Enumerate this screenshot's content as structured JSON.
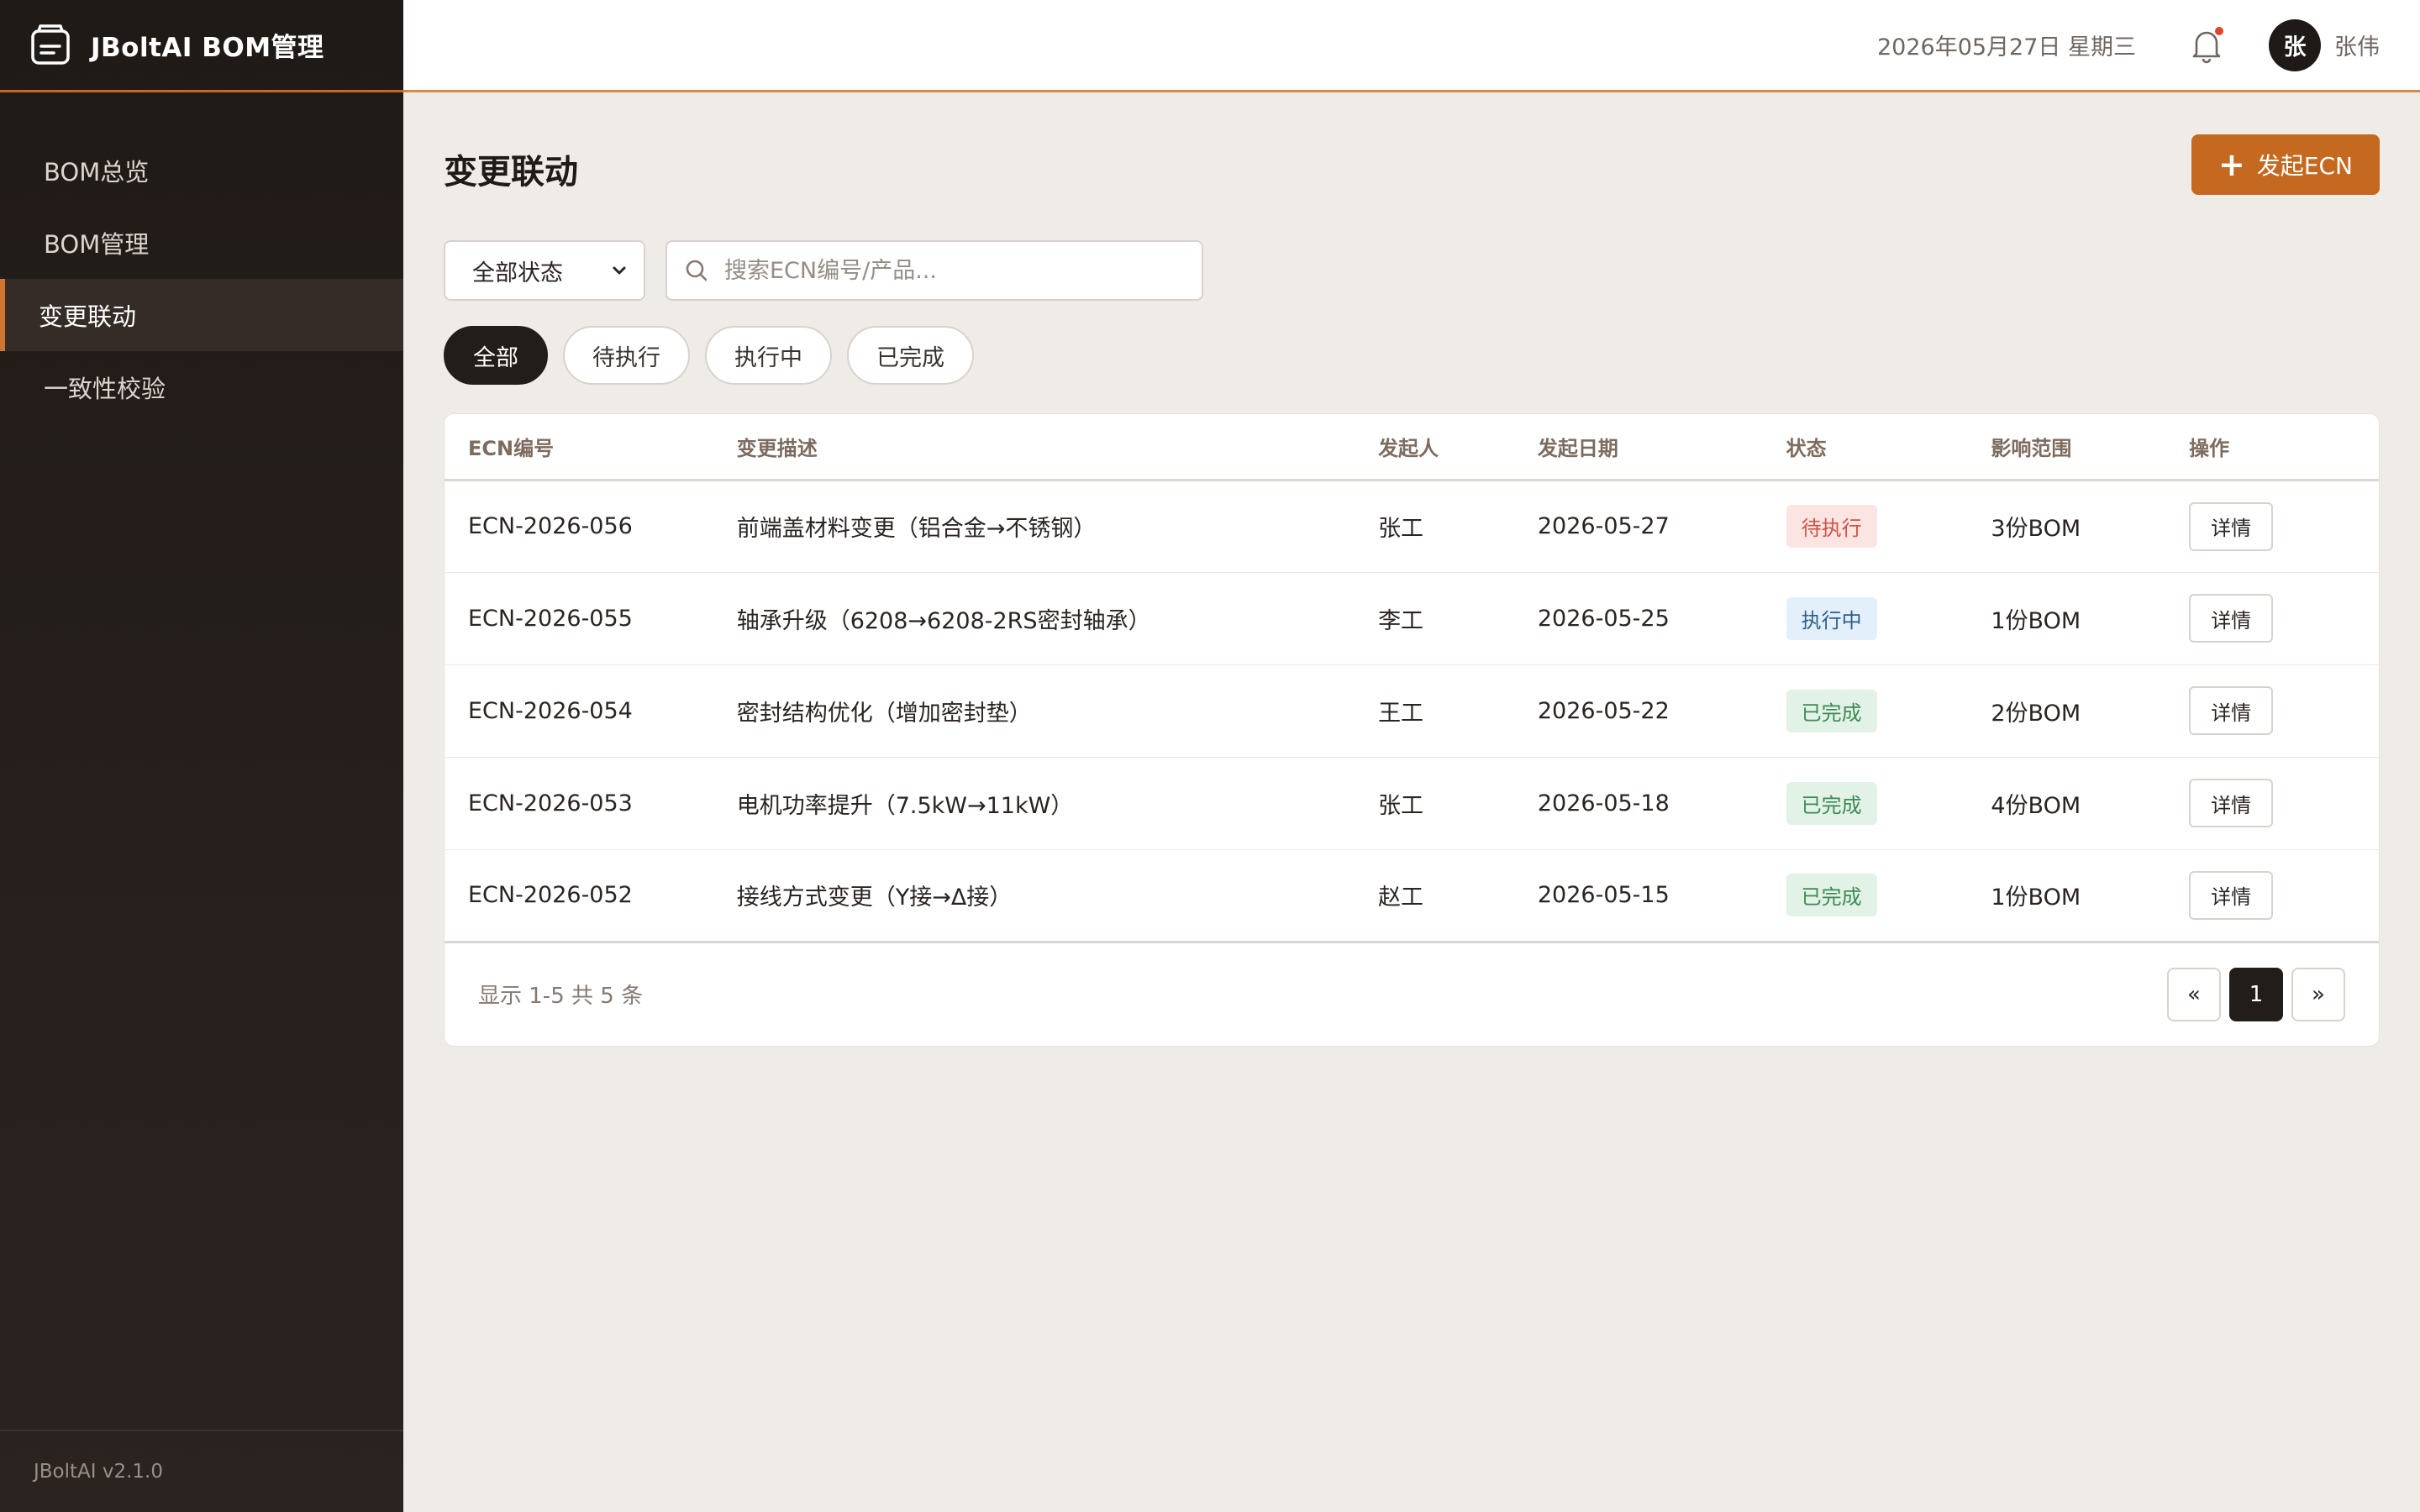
{
  "app": {
    "title": "JBoltAI BOM管理",
    "version": "JBoltAI v2.1.0"
  },
  "sidebar": {
    "items": [
      {
        "label": "BOM总览"
      },
      {
        "label": "BOM管理"
      },
      {
        "label": "变更联动"
      },
      {
        "label": "一致性校验"
      }
    ],
    "active_index": 2
  },
  "topbar": {
    "date": "2026年05月27日 星期三",
    "user_initial": "张",
    "user_name": "张伟"
  },
  "page": {
    "title": "变更联动",
    "primary_action": "发起ECN",
    "status_select": "全部状态",
    "search_placeholder": "搜索ECN编号/产品...",
    "chips": [
      "全部",
      "待执行",
      "执行中",
      "已完成"
    ]
  },
  "table": {
    "columns": [
      "ECN编号",
      "变更描述",
      "发起人",
      "发起日期",
      "状态",
      "影响范围",
      "操作"
    ],
    "rows": [
      {
        "id": "ECN-2026-056",
        "desc": "前端盖材料变更（铝合金→不锈钢）",
        "owner": "张工",
        "date": "2026-05-27",
        "status": "待执行",
        "scope": "3份BOM",
        "action": "详情"
      },
      {
        "id": "ECN-2026-055",
        "desc": "轴承升级（6208→6208-2RS密封轴承）",
        "owner": "李工",
        "date": "2026-05-25",
        "status": "执行中",
        "scope": "1份BOM",
        "action": "详情"
      },
      {
        "id": "ECN-2026-054",
        "desc": "密封结构优化（增加密封垫）",
        "owner": "王工",
        "date": "2026-05-22",
        "status": "已完成",
        "scope": "2份BOM",
        "action": "详情"
      },
      {
        "id": "ECN-2026-053",
        "desc": "电机功率提升（7.5kW→11kW）",
        "owner": "张工",
        "date": "2026-05-18",
        "status": "已完成",
        "scope": "4份BOM",
        "action": "详情"
      },
      {
        "id": "ECN-2026-052",
        "desc": "接线方式变更（Y接→Δ接）",
        "owner": "赵工",
        "date": "2026-05-15",
        "status": "已完成",
        "scope": "1份BOM",
        "action": "详情"
      }
    ]
  },
  "pagination": {
    "info": "显示 1-5 共 5 条",
    "prev": "«",
    "current": "1",
    "next": "»"
  },
  "colors": {
    "accent": "#c4691f",
    "sidebar": "#221c19",
    "background": "#efece7"
  }
}
